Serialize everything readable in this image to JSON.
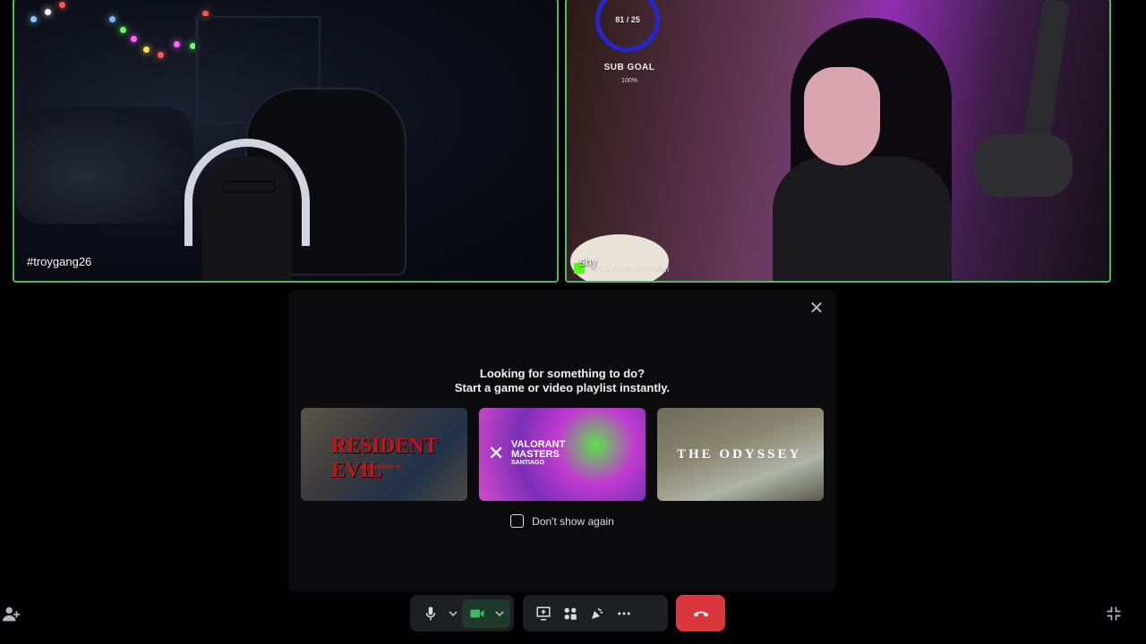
{
  "tiles": {
    "left": {
      "name": "#troygang26"
    },
    "right": {
      "name": "shy",
      "overlay": {
        "goal_count": "81 / 25",
        "goal_label": "SUB GOAL",
        "goal_percent": "100%",
        "url": "KICK.COM/SHYRUMI"
      }
    }
  },
  "activity_panel": {
    "heading_line1": "Looking for something to do?",
    "heading_line2": "Start a game or video playlist instantly.",
    "cards": [
      {
        "title": "RESIDENT EVIL",
        "subtitle": "SEPTEMBER 18"
      },
      {
        "title_line1": "VALORANT",
        "title_line2": "MASTERS",
        "subtitle": "SANTIAGO"
      },
      {
        "title": "THE ODYSSEY"
      }
    ],
    "dont_show_label": "Don't show again"
  },
  "colors": {
    "speaking_border": "#4bb86d",
    "hangup": "#da373c",
    "camera_on": "#3fb86b",
    "panel_bg": "#0b0b0e"
  },
  "controls": {
    "icons": [
      "microphone-icon",
      "camera-icon",
      "screen-share-icon",
      "activities-icon",
      "soundboard-icon",
      "more-icon",
      "hang-up-icon",
      "add-person-icon",
      "exit-fullscreen-icon"
    ]
  }
}
